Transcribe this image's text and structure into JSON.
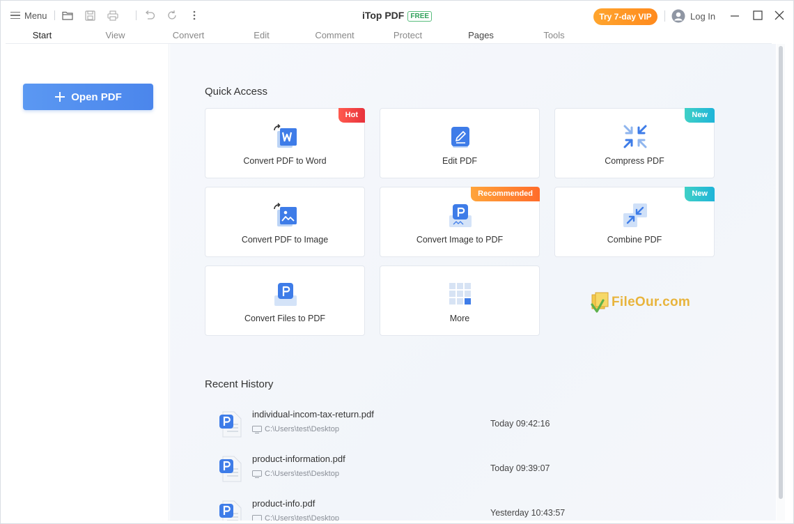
{
  "app": {
    "title": "iTop PDF",
    "edition_badge": "FREE",
    "vip_button": "Try 7-day VIP",
    "login": "Log In",
    "menu_label": "Menu"
  },
  "tabs": [
    {
      "label": "Start",
      "active": true
    },
    {
      "label": "View"
    },
    {
      "label": "Convert"
    },
    {
      "label": "Edit"
    },
    {
      "label": "Comment"
    },
    {
      "label": "Protect"
    },
    {
      "label": "Pages"
    },
    {
      "label": "Tools"
    }
  ],
  "sidebar": {
    "open_button": "Open PDF"
  },
  "quick_access": {
    "title": "Quick Access",
    "cards": [
      {
        "label": "Convert PDF to Word",
        "icon": "pdf-to-word-icon",
        "badge": "Hot"
      },
      {
        "label": "Edit PDF",
        "icon": "edit-pdf-icon",
        "badge": ""
      },
      {
        "label": "Compress PDF",
        "icon": "compress-pdf-icon",
        "badge": "New"
      },
      {
        "label": "Convert PDF to Image",
        "icon": "pdf-to-image-icon",
        "badge": ""
      },
      {
        "label": "Convert Image to PDF",
        "icon": "image-to-pdf-icon",
        "badge": "Recommended"
      },
      {
        "label": "Combine PDF",
        "icon": "combine-pdf-icon",
        "badge": "New"
      },
      {
        "label": "Convert Files to PDF",
        "icon": "files-to-pdf-icon",
        "badge": ""
      },
      {
        "label": "More",
        "icon": "more-grid-icon",
        "badge": ""
      }
    ]
  },
  "watermark": "FileOur.com",
  "recent_history": {
    "title": "Recent History",
    "items": [
      {
        "name": "individual-incom-tax-return.pdf",
        "path": "C:\\Users\\test\\Desktop",
        "time": "Today 09:42:16"
      },
      {
        "name": "product-information.pdf",
        "path": "C:\\Users\\test\\Desktop",
        "time": "Today 09:39:07"
      },
      {
        "name": "product-info.pdf",
        "path": "C:\\Users\\test\\Desktop",
        "time": "Yesterday 10:43:57"
      }
    ]
  },
  "colors": {
    "accent_blue": "#4b86ec",
    "vip_orange": "#ff9a26",
    "free_green": "#2fa05a",
    "hot_red": "#e8323c",
    "new_teal": "#1fb4d8",
    "recommended_orange": "#ff7a2e"
  }
}
